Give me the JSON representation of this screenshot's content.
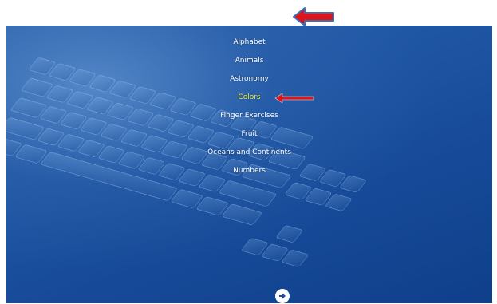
{
  "menu": {
    "items": [
      {
        "label": "Alphabet"
      },
      {
        "label": "Animals"
      },
      {
        "label": "Astronomy"
      },
      {
        "label": "Colors"
      },
      {
        "label": "Finger Exercises"
      },
      {
        "label": "Fruit"
      },
      {
        "label": "Oceans and Continents"
      },
      {
        "label": "Numbers"
      }
    ],
    "selected": "Colors"
  },
  "icons": {
    "top_annotation": "left-arrow-icon",
    "item_annotation": "left-arrow-icon",
    "next": "right-arrow-icon"
  },
  "colors": {
    "background_blue": "#1f56a4",
    "menu_text": "#ffffff",
    "selected_text": "#f2ef2a",
    "annotation_red": "#e0141b"
  }
}
